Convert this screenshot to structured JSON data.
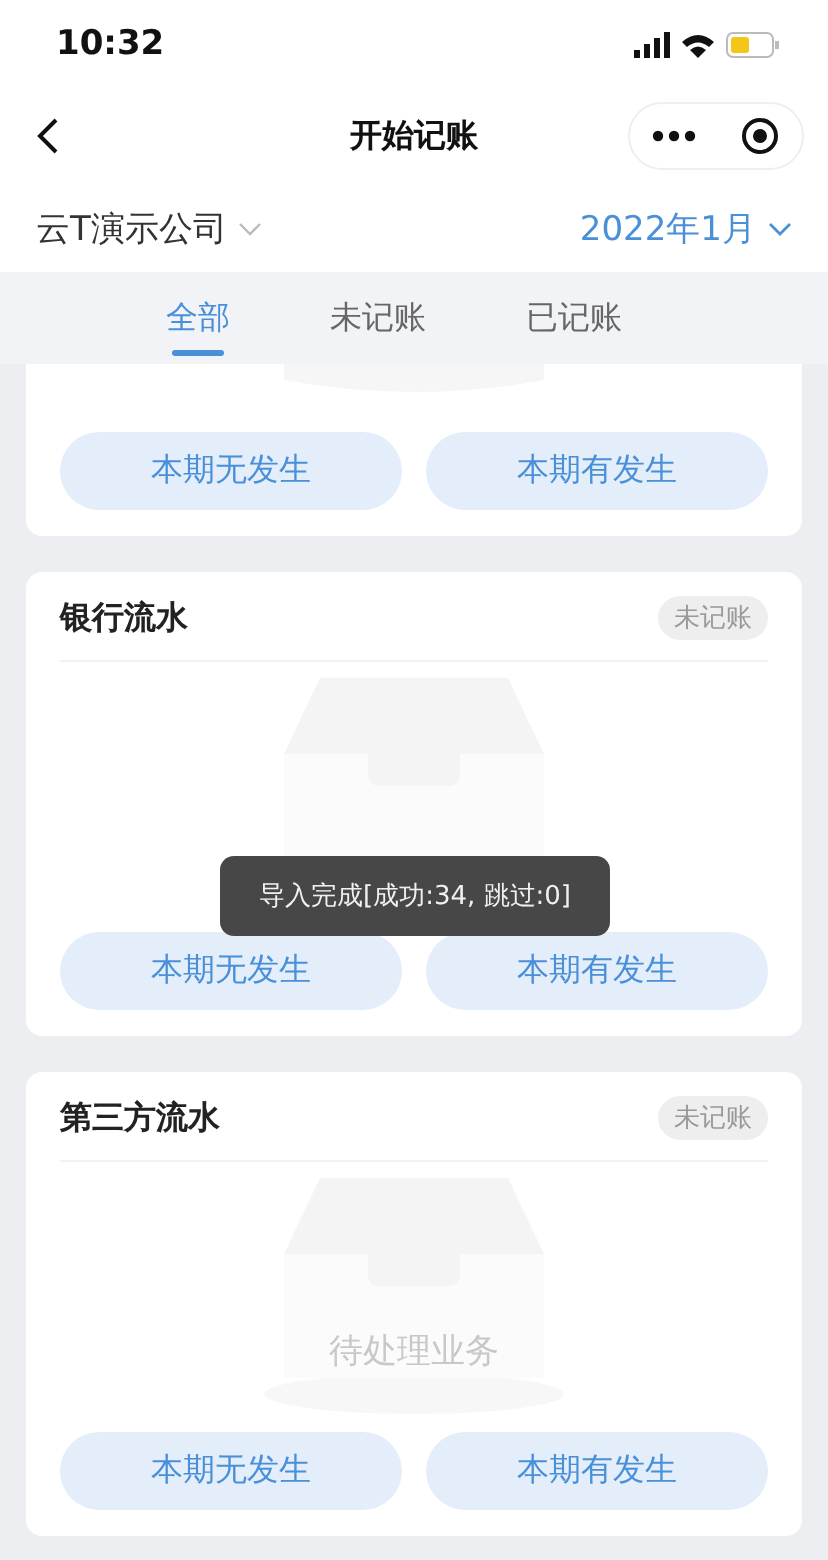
{
  "status_bar": {
    "time": "10:32"
  },
  "nav": {
    "title": "开始记账"
  },
  "filter": {
    "company": "云T演示公司",
    "period": "2022年1月"
  },
  "tabs": [
    {
      "label": "全部",
      "selected": true
    },
    {
      "label": "未记账",
      "selected": false
    },
    {
      "label": "已记账",
      "selected": false
    }
  ],
  "cards": [
    {
      "kind": "partial",
      "buttons": [
        "本期无发生",
        "本期有发生"
      ]
    },
    {
      "kind": "full",
      "title": "银行流水",
      "badge": "未记账",
      "buttons": [
        "本期无发生",
        "本期有发生"
      ]
    },
    {
      "kind": "full",
      "title": "第三方流水",
      "badge": "未记账",
      "placeholder": "待处理业务",
      "buttons": [
        "本期无发生",
        "本期有发生"
      ]
    }
  ],
  "toast": {
    "text": "导入完成[成功:34, 跳过:0]"
  }
}
